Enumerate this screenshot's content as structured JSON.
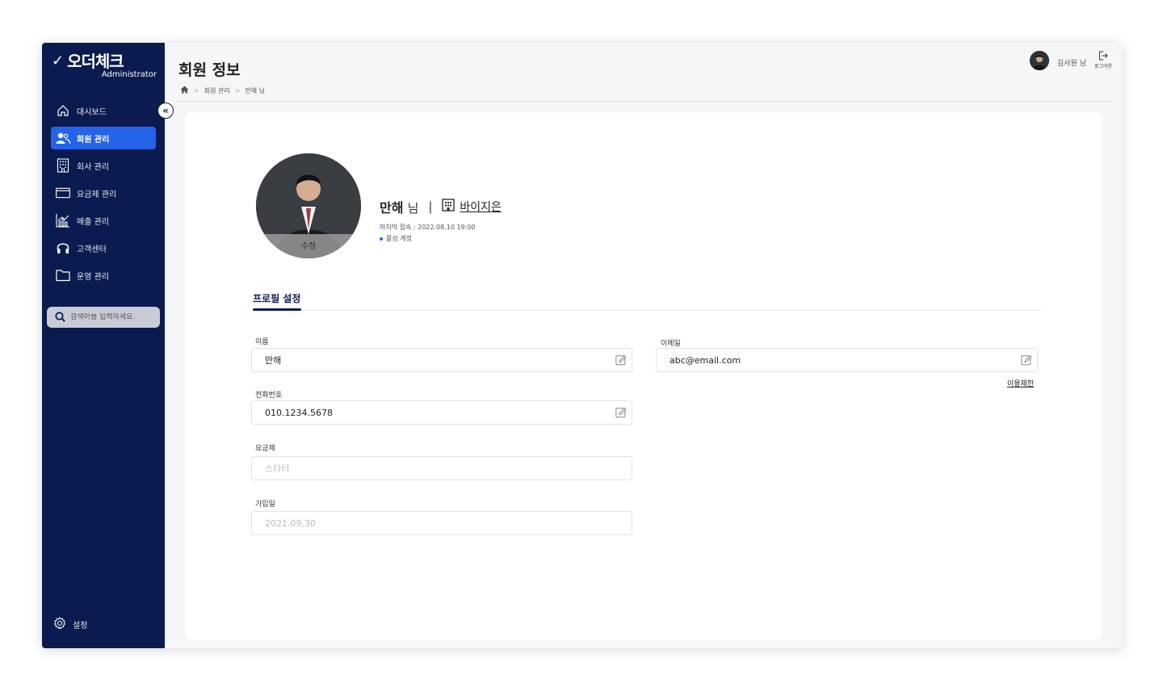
{
  "app": {
    "logo_title": "오더체크",
    "logo_subtitle": "Administrator"
  },
  "sidebar": {
    "items": [
      {
        "label": "대시보드",
        "icon": "home-icon"
      },
      {
        "label": "회원 관리",
        "icon": "users-icon",
        "active": true
      },
      {
        "label": "회사 관리",
        "icon": "building-icon"
      },
      {
        "label": "요금제 관리",
        "icon": "card-icon"
      },
      {
        "label": "매출 관리",
        "icon": "chart-icon"
      },
      {
        "label": "고객센터",
        "icon": "headset-icon"
      },
      {
        "label": "운영 관리",
        "icon": "folder-icon"
      }
    ],
    "search_placeholder": "검색어를 입력하세요.",
    "settings_label": "설정"
  },
  "header": {
    "title": "회원 정보",
    "breadcrumb": [
      "회원 관리",
      "만해 님"
    ],
    "user_name": "김사원 님",
    "logout_label": "로그아웃"
  },
  "profile": {
    "photo_edit_label": "수정",
    "name": "만해",
    "honorific": "님",
    "separator": "|",
    "company": "바이지은",
    "last_access": "마지막 접속 : 2022.08.10 19:00",
    "status": "활성 계정"
  },
  "tabs": {
    "active": "프로필 설정"
  },
  "form": {
    "name_label": "이름",
    "name_value": "만해",
    "email_label": "이메일",
    "email_value": "abc@email.com",
    "restrict_label": "이용제한",
    "phone_label": "전화번호",
    "phone_value": "010.1234.5678",
    "plan_label": "요금제",
    "plan_value": "스타터",
    "join_label": "가입일",
    "join_value": "2021.09.30"
  },
  "colors": {
    "sidebar_bg": "#0b1b4f",
    "accent": "#2563eb"
  }
}
